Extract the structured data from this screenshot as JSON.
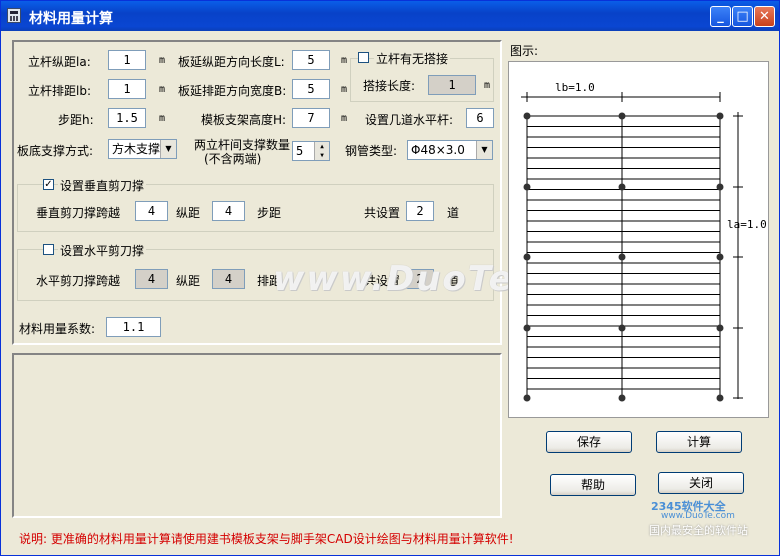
{
  "window": {
    "title": "材料用量计算"
  },
  "params": {
    "la_label": "立杆纵距la:",
    "la_value": "1",
    "la_unit": "m",
    "lb_label": "立杆排距lb:",
    "lb_value": "1",
    "lb_unit": "m",
    "h_label": "步距h:",
    "h_value": "1.5",
    "h_unit": "m",
    "L_label": "板延纵距方向长度L:",
    "L_value": "5",
    "L_unit": "m",
    "B_label": "板延排距方向宽度B:",
    "B_value": "5",
    "B_unit": "m",
    "H_label": "模板支架高度H:",
    "H_value": "7",
    "H_unit": "m",
    "lap_check_label": "立杆有无搭接",
    "lap_len_label": "搭接长度:",
    "lap_len_value": "1",
    "lap_len_unit": "m",
    "horiz_count_label": "设置几道水平杆:",
    "horiz_count_value": "6",
    "support_mode_label": "板底支撑方式:",
    "support_mode_value": "方木支撑",
    "between_label_1": "两立杆间支撑数量",
    "between_label_2": "(不含两端)",
    "between_value": "5",
    "steel_label": "钢管类型:",
    "steel_value": "Φ48×3.0"
  },
  "vertical_brace": {
    "check_label": "设置垂直剪刀撑",
    "checked": true,
    "span_label": "垂直剪刀撑跨越",
    "span_a": "4",
    "mid_label": "纵距",
    "span_b": "4",
    "tail_label": "步距",
    "total_label": "共设置",
    "total_value": "2",
    "unit_label": "道"
  },
  "horizontal_brace": {
    "check_label": "设置水平剪刀撑",
    "checked": false,
    "span_label": "水平剪刀撑跨越",
    "span_a": "4",
    "mid_label": "纵距",
    "span_b": "4",
    "tail_label": "排距",
    "total_label": "共设置",
    "total_value": "2",
    "unit_label": "道"
  },
  "coef": {
    "label": "材料用量系数:",
    "value": "1.1"
  },
  "diagram": {
    "label": "图示:",
    "lb_text": "lb=1.0",
    "la_text": "la=1.0"
  },
  "buttons": {
    "save": "保存",
    "calc": "计算",
    "help": "帮助",
    "close": "关闭"
  },
  "note": "说明: 更准确的材料用量计算请使用建书模板支架与脚手架CAD设计绘图与材料用量计算软件!",
  "watermark": {
    "main": "www.DuoTe.com",
    "brand": "2345软件大全",
    "brand_url": "www.DuoTe.com",
    "brand_slogan": "国内最安全的软件站"
  }
}
